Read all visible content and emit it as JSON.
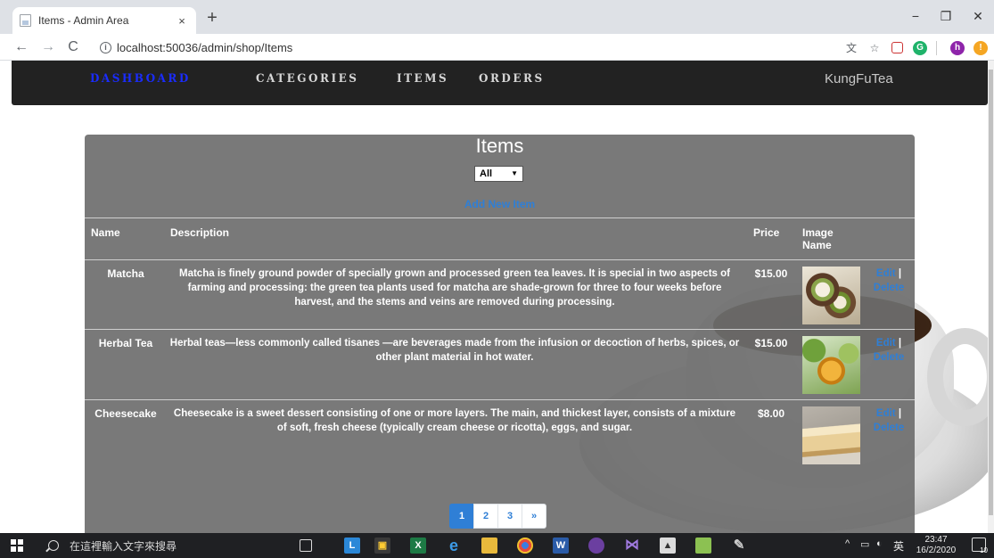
{
  "browser": {
    "tab_title": "Items - Admin Area",
    "tab_close": "×",
    "new_tab": "+",
    "url": "localhost:50036/admin/shop/Items",
    "window_minimize": "−",
    "window_restore": "❐",
    "window_close": "✕",
    "profile_initial": "h"
  },
  "nav": {
    "items": [
      {
        "label": "DASHBOARD",
        "active": true
      },
      {
        "label": "CATEGORIES",
        "active": false
      },
      {
        "label": "ITEMS",
        "active": false
      },
      {
        "label": "ORDERS",
        "active": false
      }
    ],
    "brand": "KungFuTea"
  },
  "page": {
    "title": "Items",
    "filter": {
      "selected": "All"
    },
    "add_link": "Add New Item",
    "columns": [
      "Name",
      "Description",
      "Price",
      "Image\nName"
    ],
    "actions": {
      "edit": "Edit",
      "separator": "|",
      "delete": "Delete"
    },
    "rows": [
      {
        "name": "Matcha",
        "description": "Matcha is finely ground powder of specially grown and processed green tea leaves. It is special in two aspects of farming and processing: the green tea plants used for matcha are shade-grown for three to four weeks before harvest, and the stems and veins are removed during processing.",
        "price": "$15.00"
      },
      {
        "name": "Herbal Tea",
        "description": "Herbal teas—less commonly called tisanes —are beverages made from the infusion or decoction of herbs, spices, or other plant material in hot water.",
        "price": "$15.00"
      },
      {
        "name": "Cheesecake",
        "description": "Cheesecake is a sweet dessert consisting of one or more layers. The main, and thickest layer, consists of a mixture of soft, fresh cheese (typically cream cheese or ricotta), eggs, and sugar.",
        "price": "$8.00"
      }
    ],
    "pagination": {
      "pages": [
        "1",
        "2",
        "3"
      ],
      "current": "1",
      "next": "»"
    }
  },
  "taskbar": {
    "search_placeholder": "在這裡輸入文字來搜尋",
    "tray_lang": "英",
    "tray_up": "^",
    "time": "23:47",
    "date": "16/2/2020",
    "notification_count": "10"
  }
}
